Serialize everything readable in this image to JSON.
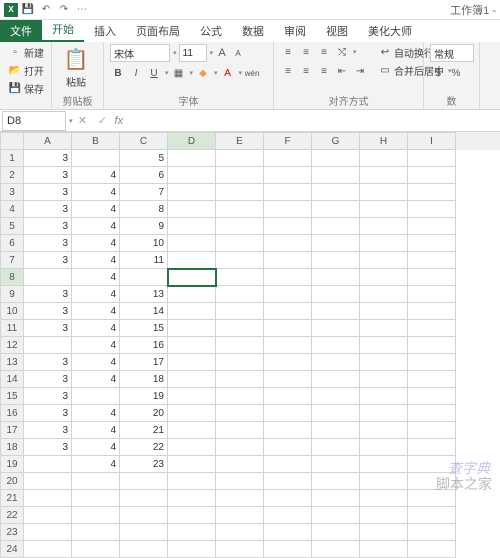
{
  "title": "工作簿1 -",
  "qat": {
    "save": "💾",
    "undo": "↶",
    "redo": "↷",
    "more": "⋯"
  },
  "tabs": {
    "file": "文件",
    "home": "开始",
    "insert": "插入",
    "layout": "页面布局",
    "formula": "公式",
    "data": "数据",
    "review": "审阅",
    "view": "视图",
    "beautify": "美化大师"
  },
  "ribbon": {
    "group_file": {
      "new": "新建",
      "open": "打开",
      "save": "保存"
    },
    "clipboard": {
      "paste": "粘贴",
      "label": "剪贴板"
    },
    "font": {
      "name": "宋体",
      "size": "11",
      "label": "字体",
      "inc": "A",
      "dec": "A",
      "wen": "wén"
    },
    "align": {
      "label": "对齐方式",
      "wrap": "自动换行",
      "merge": "合并后居中"
    },
    "number": {
      "label": "数",
      "format": "常规"
    }
  },
  "namebox": "D8",
  "fx": "fx",
  "columns": [
    "A",
    "B",
    "C",
    "D",
    "E",
    "F",
    "G",
    "H",
    "I"
  ],
  "active_col": 3,
  "active_row": 7,
  "chart_data": {
    "type": "table",
    "rows": [
      {
        "r": 1,
        "A": 3,
        "B": "",
        "C": 5
      },
      {
        "r": 2,
        "A": 3,
        "B": 4,
        "C": 6
      },
      {
        "r": 3,
        "A": 3,
        "B": 4,
        "C": 7
      },
      {
        "r": 4,
        "A": 3,
        "B": 4,
        "C": 8
      },
      {
        "r": 5,
        "A": 3,
        "B": 4,
        "C": 9
      },
      {
        "r": 6,
        "A": 3,
        "B": 4,
        "C": 10
      },
      {
        "r": 7,
        "A": 3,
        "B": 4,
        "C": 11
      },
      {
        "r": 8,
        "A": "",
        "B": 4,
        "C": ""
      },
      {
        "r": 9,
        "A": 3,
        "B": 4,
        "C": 13
      },
      {
        "r": 10,
        "A": 3,
        "B": 4,
        "C": 14
      },
      {
        "r": 11,
        "A": 3,
        "B": 4,
        "C": 15
      },
      {
        "r": 12,
        "A": "",
        "B": 4,
        "C": 16
      },
      {
        "r": 13,
        "A": 3,
        "B": 4,
        "C": 17
      },
      {
        "r": 14,
        "A": 3,
        "B": 4,
        "C": 18
      },
      {
        "r": 15,
        "A": 3,
        "B": "",
        "C": 19
      },
      {
        "r": 16,
        "A": 3,
        "B": 4,
        "C": 20
      },
      {
        "r": 17,
        "A": 3,
        "B": 4,
        "C": 21
      },
      {
        "r": 18,
        "A": 3,
        "B": 4,
        "C": 22
      },
      {
        "r": 19,
        "A": "",
        "B": 4,
        "C": 23
      },
      {
        "r": 20
      },
      {
        "r": 21
      },
      {
        "r": 22
      },
      {
        "r": 23
      },
      {
        "r": 24
      }
    ]
  },
  "watermark1": "脚本之家",
  "watermark2": "查字典"
}
